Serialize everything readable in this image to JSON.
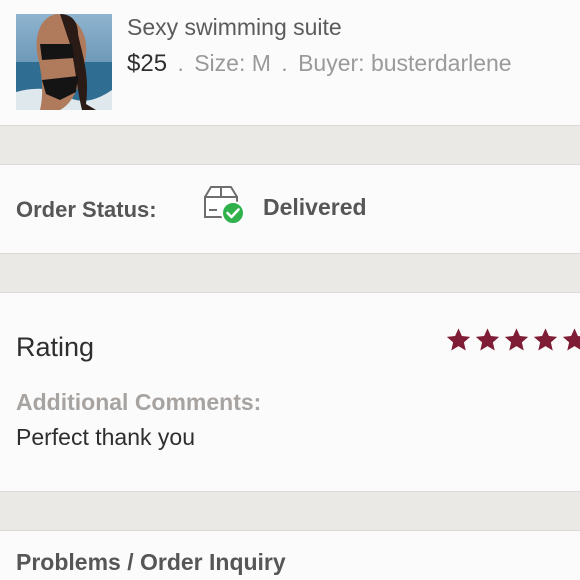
{
  "product": {
    "title": "Sexy swimming suite",
    "price": "$25",
    "size": "Size: M",
    "buyer": "Buyer: busterdarlene",
    "separator": "."
  },
  "order_status": {
    "label": "Order Status:",
    "value": "Delivered",
    "icon": "package-delivered-icon",
    "check_color": "#2fb24c"
  },
  "rating": {
    "title": "Rating",
    "stars": 5,
    "star_color": "#7e1d35",
    "comments_label": "Additional Comments:",
    "comments": "Perfect thank you"
  },
  "inquiry": {
    "label": "Problems / Order Inquiry"
  }
}
